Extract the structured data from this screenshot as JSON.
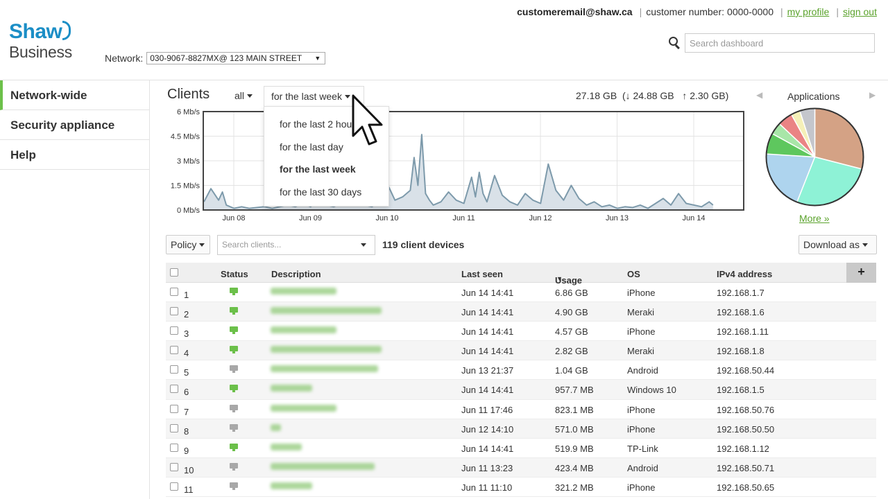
{
  "header": {
    "logo_line1": "Shaw",
    "logo_line2": "Business",
    "network_label": "Network:",
    "network_value": "030-9067-8827MX@ 123 MAIN STREET",
    "email": "customeremail@shaw.ca",
    "customer_number_label": "customer number:",
    "customer_number": "0000-0000",
    "my_profile": "my profile",
    "sign_out": "sign out",
    "search_placeholder": "Search dashboard"
  },
  "sidebar": {
    "items": [
      {
        "label": "Network-wide",
        "active": true
      },
      {
        "label": "Security appliance",
        "active": false
      },
      {
        "label": "Help",
        "active": false
      }
    ]
  },
  "clients": {
    "title": "Clients",
    "filter": "all",
    "period": "for the last week",
    "total": "27.18 GB",
    "down": "(↓ 24.88 GB",
    "up": "↑ 2.30 GB)"
  },
  "period_dropdown": {
    "options": [
      "for the last 2 hours",
      "for the last day",
      "for the last week",
      "for the last 30 days"
    ],
    "selected": "for the last week"
  },
  "chart_data": {
    "type": "area",
    "y_ticks": [
      "6 Mb/s",
      "4.5 Mb/s",
      "3 Mb/s",
      "1.5 Mb/s",
      "0 Mb/s"
    ],
    "x_ticks": [
      "Jun 08",
      "Jun 09",
      "Jun 10",
      "Jun 11",
      "Jun 12",
      "Jun 13",
      "Jun 14"
    ],
    "ylim": [
      0,
      6
    ],
    "unit": "Mb/s",
    "grid": true,
    "line_color": "#7d9aab",
    "fill_color": "#d9e1e8",
    "x_days": [
      0,
      0.1,
      0.2,
      0.25,
      0.3,
      0.4,
      0.5,
      0.6,
      0.7,
      0.8,
      0.9,
      1.0,
      1.1,
      1.2,
      1.3,
      1.4,
      1.5,
      1.6,
      1.7,
      1.8,
      1.9,
      2.0,
      2.1,
      2.2,
      2.3,
      2.4,
      2.5,
      2.6,
      2.7,
      2.75,
      2.8,
      2.85,
      2.9,
      2.95,
      3.0,
      3.1,
      3.2,
      3.3,
      3.4,
      3.5,
      3.55,
      3.6,
      3.65,
      3.7,
      3.8,
      3.9,
      4.0,
      4.1,
      4.2,
      4.3,
      4.4,
      4.5,
      4.6,
      4.7,
      4.8,
      4.9,
      5.0,
      5.1,
      5.2,
      5.3,
      5.4,
      5.5,
      5.6,
      5.7,
      5.8,
      5.9,
      6.0,
      6.1,
      6.2,
      6.3,
      6.4,
      6.5,
      6.6,
      6.65
    ],
    "values": [
      0.5,
      1.3,
      0.6,
      1.1,
      0.3,
      0.1,
      0.2,
      0.1,
      0.15,
      0.2,
      0.1,
      0.2,
      0.3,
      0.2,
      0.4,
      0.2,
      0.6,
      0.3,
      0.2,
      0.4,
      1.5,
      0.8,
      0.3,
      0.2,
      0.5,
      1.6,
      0.6,
      0.8,
      1.2,
      3.2,
      1.5,
      4.6,
      1.0,
      0.6,
      0.3,
      0.5,
      1.1,
      0.6,
      0.4,
      2.0,
      0.8,
      2.3,
      1.0,
      0.5,
      2.1,
      0.9,
      0.5,
      0.3,
      1.0,
      0.6,
      0.4,
      2.8,
      1.2,
      0.6,
      1.5,
      0.7,
      0.3,
      0.5,
      0.2,
      0.3,
      0.1,
      0.2,
      0.15,
      0.3,
      0.1,
      0.4,
      0.7,
      0.3,
      1.0,
      0.4,
      0.3,
      0.2,
      0.5,
      0.3
    ]
  },
  "applications": {
    "title": "Applications",
    "more": "More »",
    "slices": [
      {
        "value": 29,
        "color": "#d4a285"
      },
      {
        "value": 27,
        "color": "#8ef2d6"
      },
      {
        "value": 20,
        "color": "#aed4ee"
      },
      {
        "value": 7,
        "color": "#5ec75e"
      },
      {
        "value": 4,
        "color": "#a8e6a8"
      },
      {
        "value": 5,
        "color": "#ea8484"
      },
      {
        "value": 3,
        "color": "#f5f0b8"
      },
      {
        "value": 5,
        "color": "#c4c6cc"
      }
    ]
  },
  "toolbar": {
    "policy": "Policy",
    "search_placeholder": "Search clients...",
    "count": "119 client devices",
    "download": "Download as"
  },
  "table": {
    "columns": [
      "Status",
      "Description",
      "Last seen",
      "Usage",
      "OS",
      "IPv4 address"
    ],
    "sort_indicator": "▼",
    "plus": "+",
    "rows": [
      {
        "num": "1",
        "online": true,
        "last_seen": "Jun 14 14:41",
        "usage": "6.86 GB",
        "os": "iPhone",
        "ip": "192.168.1.7"
      },
      {
        "num": "2",
        "online": true,
        "last_seen": "Jun 14 14:41",
        "usage": "4.90 GB",
        "os": "Meraki",
        "ip": "192.168.1.6"
      },
      {
        "num": "3",
        "online": true,
        "last_seen": "Jun 14 14:41",
        "usage": "4.57 GB",
        "os": "iPhone",
        "ip": "192.168.1.11"
      },
      {
        "num": "4",
        "online": true,
        "last_seen": "Jun 14 14:41",
        "usage": "2.82 GB",
        "os": "Meraki",
        "ip": "192.168.1.8"
      },
      {
        "num": "5",
        "online": false,
        "last_seen": "Jun 13 21:37",
        "usage": "1.04 GB",
        "os": "Android",
        "ip": "192.168.50.44"
      },
      {
        "num": "6",
        "online": true,
        "last_seen": "Jun 14 14:41",
        "usage": "957.7 MB",
        "os": "Windows 10",
        "ip": "192.168.1.5"
      },
      {
        "num": "7",
        "online": false,
        "last_seen": "Jun 11 17:46",
        "usage": "823.1 MB",
        "os": "iPhone",
        "ip": "192.168.50.76"
      },
      {
        "num": "8",
        "online": false,
        "last_seen": "Jun 12 14:10",
        "usage": "571.0 MB",
        "os": "iPhone",
        "ip": "192.168.50.50"
      },
      {
        "num": "9",
        "online": true,
        "last_seen": "Jun 14 14:41",
        "usage": "519.9 MB",
        "os": "TP-Link",
        "ip": "192.168.1.12"
      },
      {
        "num": "10",
        "online": false,
        "last_seen": "Jun 11 13:23",
        "usage": "423.4 MB",
        "os": "Android",
        "ip": "192.168.50.71"
      },
      {
        "num": "11",
        "online": false,
        "last_seen": "Jun 11 11:10",
        "usage": "321.2 MB",
        "os": "iPhone",
        "ip": "192.168.50.65"
      }
    ]
  },
  "colors": {
    "brand": "#1b8ec6",
    "accent_green": "#5aa22b",
    "status_online": "#6cc04a",
    "status_offline": "#a8a8a8"
  }
}
